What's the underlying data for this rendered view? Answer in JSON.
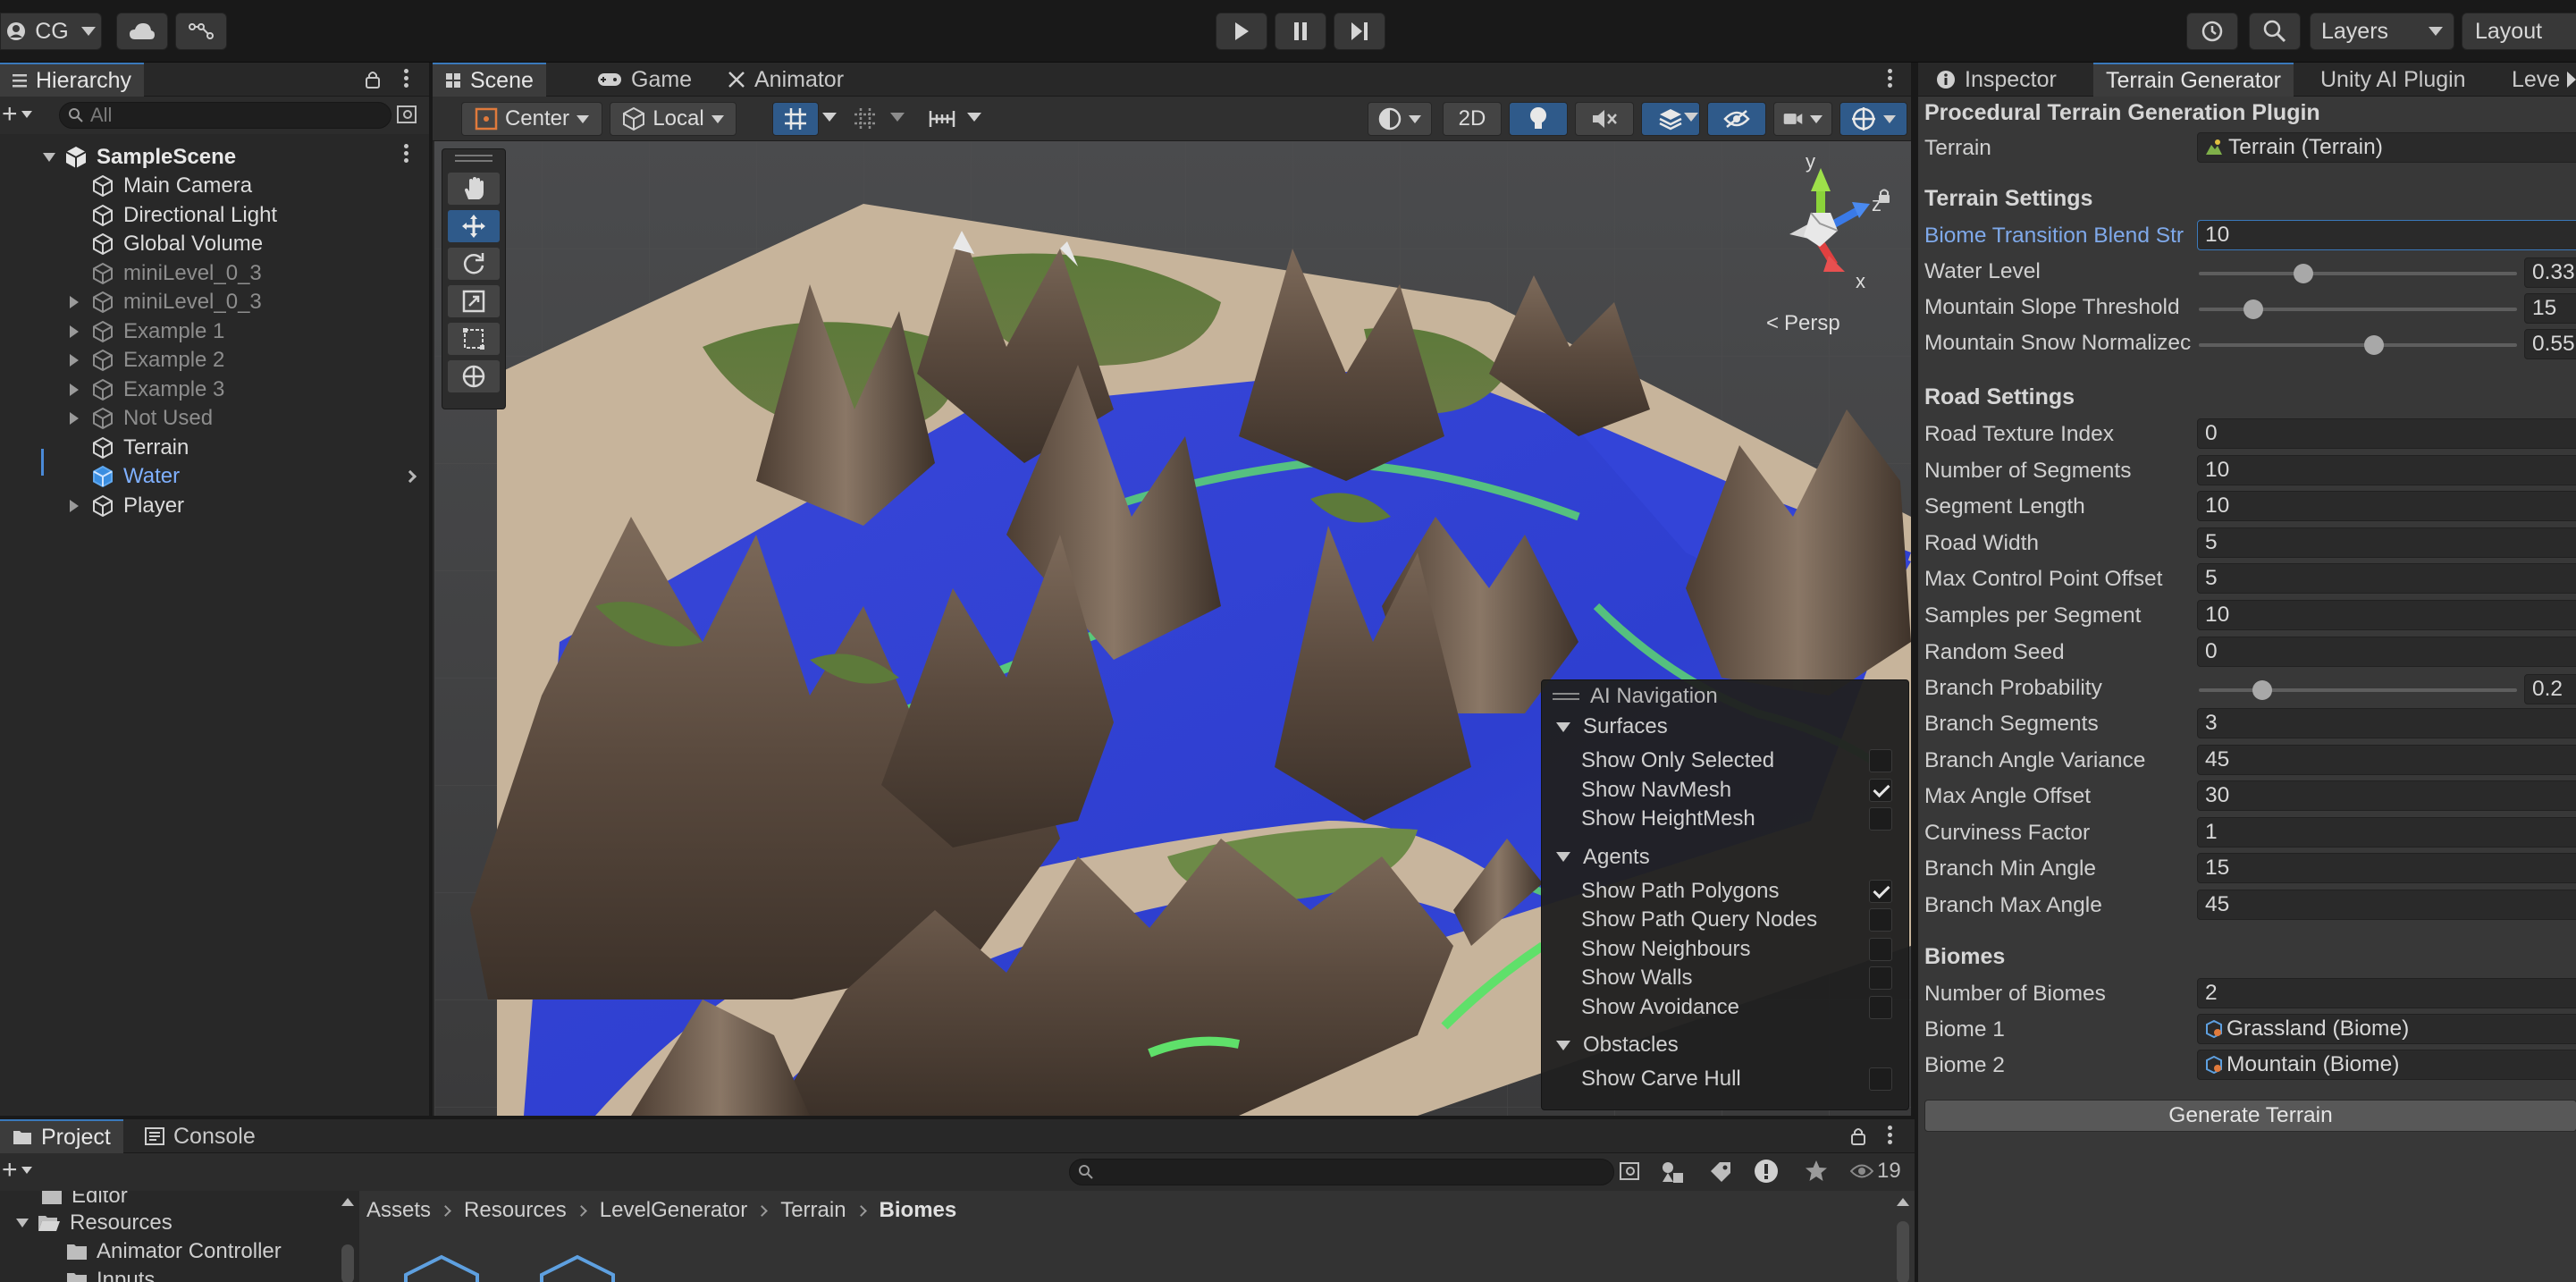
{
  "topbar": {
    "account": "CG",
    "layers": "Layers",
    "layout": "Layout"
  },
  "hierarchy": {
    "title": "Hierarchy",
    "search_placeholder": "All",
    "scene": "SampleScene",
    "items": [
      {
        "label": "Main Camera",
        "dim": false
      },
      {
        "label": "Directional Light",
        "dim": false
      },
      {
        "label": "Global Volume",
        "dim": false
      },
      {
        "label": "miniLevel_0_3",
        "dim": true
      },
      {
        "label": "miniLevel_0_3",
        "dim": true
      },
      {
        "label": "Example 1",
        "dim": true
      },
      {
        "label": "Example 2",
        "dim": true
      },
      {
        "label": "Example 3",
        "dim": true
      },
      {
        "label": "Not Used",
        "dim": true
      },
      {
        "label": "Terrain",
        "dim": false
      },
      {
        "label": "Water",
        "dim": false
      },
      {
        "label": "Player",
        "dim": false
      }
    ]
  },
  "scene": {
    "tabs": [
      "Scene",
      "Game",
      "Animator"
    ],
    "pivot": "Center",
    "space": "Local",
    "mode2d": "2D",
    "persp": "Persp",
    "gizmo": {
      "x": "x",
      "y": "y",
      "z": "z"
    }
  },
  "ainav": {
    "title": "AI Navigation",
    "surfaces": {
      "title": "Surfaces",
      "items": [
        {
          "label": "Show Only Selected",
          "checked": false
        },
        {
          "label": "Show NavMesh",
          "checked": true
        },
        {
          "label": "Show HeightMesh",
          "checked": false
        }
      ]
    },
    "agents": {
      "title": "Agents",
      "items": [
        {
          "label": "Show Path Polygons",
          "checked": true
        },
        {
          "label": "Show Path Query Nodes",
          "checked": false
        },
        {
          "label": "Show Neighbours",
          "checked": false
        },
        {
          "label": "Show Walls",
          "checked": false
        },
        {
          "label": "Show Avoidance",
          "checked": false
        }
      ]
    },
    "obstacles": {
      "title": "Obstacles",
      "items": [
        {
          "label": "Show Carve Hull",
          "checked": false
        }
      ]
    }
  },
  "inspector": {
    "tabs": [
      "Inspector",
      "Terrain Generator",
      "Unity AI Plugin",
      "Leve"
    ],
    "plugin_title": "Procedural Terrain Generation Plugin",
    "terrain_label": "Terrain",
    "terrain_value": "Terrain (Terrain)",
    "terrain_settings": "Terrain Settings",
    "biome_blend_label": "Biome Transition Blend Str",
    "biome_blend_value": "10",
    "water_level_label": "Water Level",
    "water_level_value": "0.33",
    "water_level_frac": 0.33,
    "mountain_slope_label": "Mountain Slope Threshold",
    "mountain_slope_value": "15",
    "mountain_slope_frac": 0.17,
    "mountain_snow_label": "Mountain Snow Normalizec",
    "mountain_snow_value": "0.55",
    "mountain_snow_frac": 0.55,
    "road_settings": "Road Settings",
    "road_fields": [
      {
        "label": "Road Texture Index",
        "value": "0"
      },
      {
        "label": "Number of Segments",
        "value": "10"
      },
      {
        "label": "Segment Length",
        "value": "10"
      },
      {
        "label": "Road Width",
        "value": "5"
      },
      {
        "label": "Max Control Point Offset",
        "value": "5"
      },
      {
        "label": "Samples per Segment",
        "value": "10"
      },
      {
        "label": "Random Seed",
        "value": "0"
      }
    ],
    "branch_prob_label": "Branch Probability",
    "branch_prob_value": "0.2",
    "branch_prob_frac": 0.2,
    "branch_fields": [
      {
        "label": "Branch Segments",
        "value": "3"
      },
      {
        "label": "Branch Angle Variance",
        "value": "45"
      },
      {
        "label": "Max Angle Offset",
        "value": "30"
      },
      {
        "label": "Curviness Factor",
        "value": "1"
      },
      {
        "label": "Branch Min Angle",
        "value": "15"
      },
      {
        "label": "Branch Max Angle",
        "value": "45"
      }
    ],
    "biomes": "Biomes",
    "num_biomes_label": "Number of Biomes",
    "num_biomes_value": "2",
    "biome1_label": "Biome 1",
    "biome1_value": "Grassland (Biome)",
    "biome2_label": "Biome 2",
    "biome2_value": "Mountain (Biome)",
    "generate": "Generate Terrain"
  },
  "project": {
    "tabs": [
      "Project",
      "Console"
    ],
    "count": "19",
    "tree": [
      "Editor",
      "Resources",
      "Animator Controller",
      "Inputs"
    ],
    "breadcrumb": [
      "Assets",
      "Resources",
      "LevelGenerator",
      "Terrain",
      "Biomes"
    ]
  }
}
